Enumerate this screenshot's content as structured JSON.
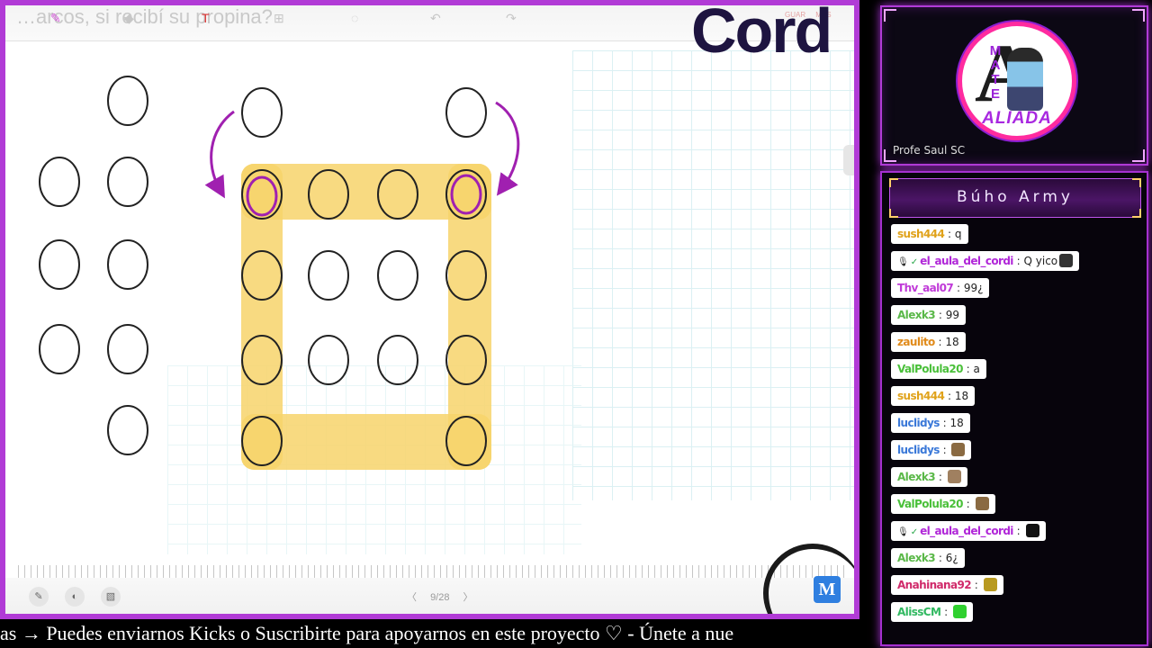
{
  "board": {
    "question_text": "…arcos, si recibí su propina?",
    "title_watermark": "Cord",
    "mini_label_1": "GUAR",
    "mini_label_2": "MAS",
    "page_indicator": "9/28",
    "prev_symbol": "〈",
    "next_symbol": "〉",
    "logo_letter": "M",
    "colors": {
      "frame": "#b13bd6",
      "highlight": "#f7d36b",
      "arrow": "#a020b0",
      "circle_stroke": "#222222"
    },
    "icons": [
      "pen-icon",
      "eraser-icon",
      "text-icon",
      "shape-icon",
      "lasso-icon",
      "undo-icon",
      "redo-icon",
      "pencil-tool-icon",
      "fill-tool-icon",
      "image-tool-icon"
    ]
  },
  "ticker": {
    "text": "as  →  Puedes enviarnos Kicks o Suscribirte para apoyarnos en este proyecto  ♡   -   Únete a nue"
  },
  "camera": {
    "logo_letters": "M\nA\nT\nE",
    "logo_big_letter": "A",
    "logo_word": "ALIADA",
    "name": "Profe Saul SC"
  },
  "chat": {
    "title": "Búho Army",
    "messages": [
      {
        "user": "sush444",
        "color": "#e0a21a",
        "text": "q"
      },
      {
        "user": "el_aula_del_cordi",
        "color": "#b026d8",
        "text": "Q yico",
        "badges": true,
        "emote": "#333333"
      },
      {
        "user": "Thv_aal07",
        "color": "#c03ad8",
        "text": "99¿"
      },
      {
        "user": "Alexk3",
        "color": "#5ab848",
        "text": "99"
      },
      {
        "user": "zaulito",
        "color": "#e08a1a",
        "text": "18"
      },
      {
        "user": "ValPolula20",
        "color": "#4ac03a",
        "text": "a"
      },
      {
        "user": "sush444",
        "color": "#e0a21a",
        "text": "18"
      },
      {
        "user": "luclidys",
        "color": "#3a78d8",
        "text": "18"
      },
      {
        "user": "luclidys",
        "color": "#3a78d8",
        "text": "",
        "emote": "#8a6a42"
      },
      {
        "user": "Alexk3",
        "color": "#5ab848",
        "text": "",
        "emote": "#a08060"
      },
      {
        "user": "ValPolula20",
        "color": "#4ac03a",
        "text": "",
        "emote": "#8a6a42"
      },
      {
        "user": "el_aula_del_cordi",
        "color": "#b026d8",
        "text": "",
        "badges": true,
        "emote": "#111111"
      },
      {
        "user": "Alexk3",
        "color": "#5ab848",
        "text": "6¿"
      },
      {
        "user": "Anahinana92",
        "color": "#d02a6a",
        "text": "",
        "emote": "#b89a20"
      },
      {
        "user": "AlissCM",
        "color": "#30b860",
        "text": "",
        "emote": "#2fd02f"
      }
    ]
  }
}
